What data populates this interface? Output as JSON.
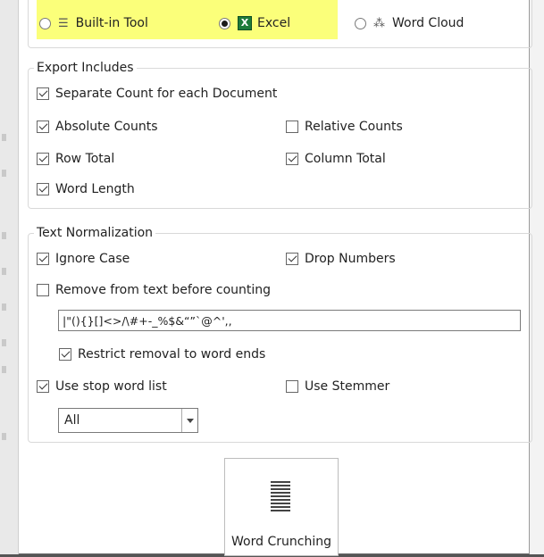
{
  "output_options": {
    "builtin_tool": {
      "label": "Built-in Tool",
      "icon": "list-icon",
      "selected": false
    },
    "excel": {
      "label": "Excel",
      "icon": "excel-icon",
      "icon_glyph": "X",
      "selected": true
    },
    "word_cloud": {
      "label": "Word Cloud",
      "icon": "word-cloud-icon",
      "selected": false
    },
    "highlight_color": "#fbff7a"
  },
  "export_includes": {
    "legend": "Export Includes",
    "separate_count": {
      "label": "Separate Count for each Document",
      "checked": true
    },
    "absolute_counts": {
      "label": "Absolute Counts",
      "checked": true
    },
    "relative_counts": {
      "label": "Relative Counts",
      "checked": false
    },
    "row_total": {
      "label": "Row Total",
      "checked": true
    },
    "column_total": {
      "label": "Column Total",
      "checked": true
    },
    "word_length": {
      "label": "Word Length",
      "checked": true
    }
  },
  "text_normalization": {
    "legend": "Text Normalization",
    "ignore_case": {
      "label": "Ignore Case",
      "checked": true
    },
    "drop_numbers": {
      "label": "Drop Numbers",
      "checked": true
    },
    "remove_from_text": {
      "label": "Remove from text before counting",
      "checked": false
    },
    "remove_chars_value": "|\"(){}[]<>/\\#+-_%$&“”`@^',,",
    "restrict_removal": {
      "label": "Restrict removal to word ends",
      "checked": true
    },
    "use_stop_word_list": {
      "label": "Use stop word list",
      "checked": true
    },
    "use_stemmer": {
      "label": "Use Stemmer",
      "checked": false
    },
    "stop_word_list_selected": "All"
  },
  "word_crunching_button": {
    "label": "Word Crunching",
    "icon": "word-crunching-icon"
  }
}
